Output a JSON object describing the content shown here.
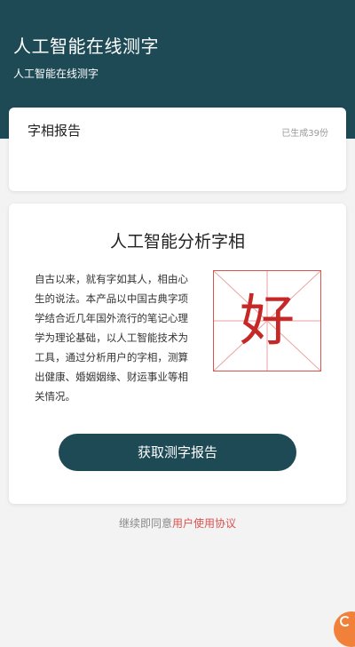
{
  "header": {
    "title": "人工智能在线测字",
    "subtitle": "人工智能在线测字"
  },
  "report_card": {
    "title": "字相报告",
    "count_text": "已生成39份"
  },
  "analysis_card": {
    "heading": "人工智能分析字相",
    "intro": "自古以来，就有字如其人，相由心生的说法。本产品以中国古典字项学结合近几年国外流行的笔记心理学为理论基础，以人工智能技术为工具，通过分析用户的字相，测算出健康、婚姻姻缘、财运事业等相关情况。",
    "sample_char": "好",
    "button_label": "获取测字报告"
  },
  "agreement": {
    "prefix": "继续即同意",
    "link_text": "用户使用协议"
  },
  "colors": {
    "primary": "#1e4a56",
    "accent_red": "#d9534f",
    "char_red": "#c62828",
    "badge_orange": "#f0803a"
  },
  "icons": {
    "corner_badge": "float-action-icon"
  }
}
